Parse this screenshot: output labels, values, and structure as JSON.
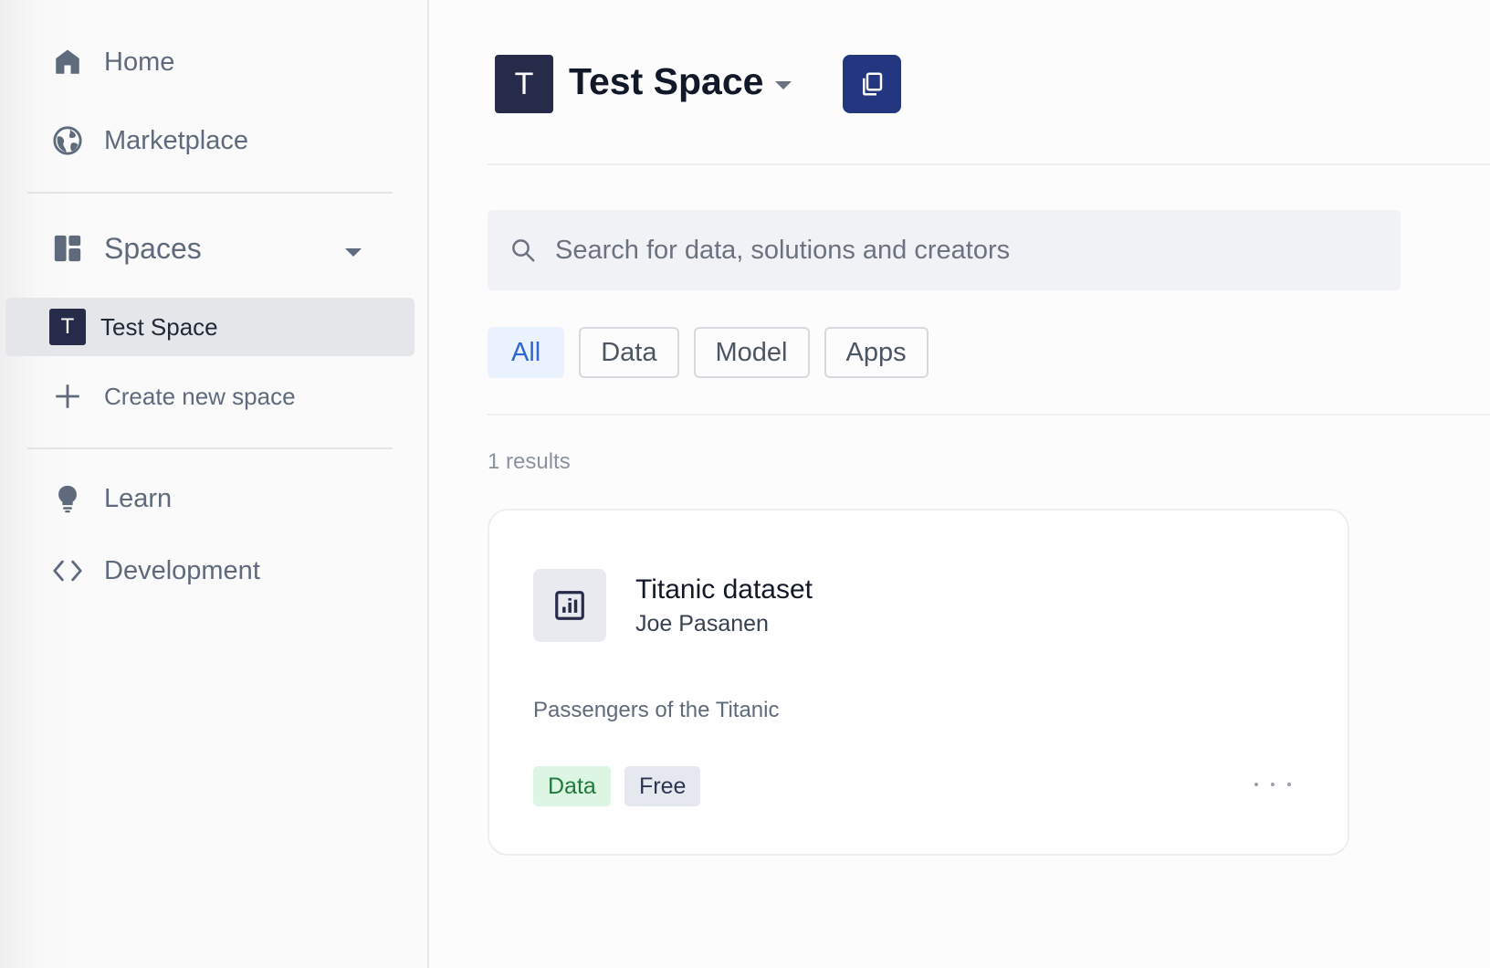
{
  "sidebar": {
    "nav": [
      {
        "label": "Home",
        "icon": "home-icon"
      },
      {
        "label": "Marketplace",
        "icon": "globe-icon"
      }
    ],
    "spaces": {
      "label": "Spaces",
      "icon": "dashboard-icon",
      "items": [
        {
          "avatar": "T",
          "label": "Test Space",
          "selected": true
        }
      ],
      "create_label": "Create new space"
    },
    "secondary": [
      {
        "label": "Learn",
        "icon": "lightbulb-icon"
      },
      {
        "label": "Development",
        "icon": "code-icon"
      }
    ]
  },
  "header": {
    "avatar": "T",
    "title": "Test Space",
    "action_color": "#24367f"
  },
  "search": {
    "placeholder": "Search for data, solutions and creators",
    "value": ""
  },
  "filters": [
    {
      "label": "All",
      "active": true
    },
    {
      "label": "Data",
      "active": false
    },
    {
      "label": "Model",
      "active": false
    },
    {
      "label": "Apps",
      "active": false
    }
  ],
  "results": {
    "count_label": "1 results",
    "items": [
      {
        "title": "Titanic dataset",
        "author": "Joe Pasanen",
        "description": "Passengers of the Titanic",
        "icon": "chart-icon",
        "tags": [
          "Data",
          "Free"
        ]
      }
    ]
  }
}
